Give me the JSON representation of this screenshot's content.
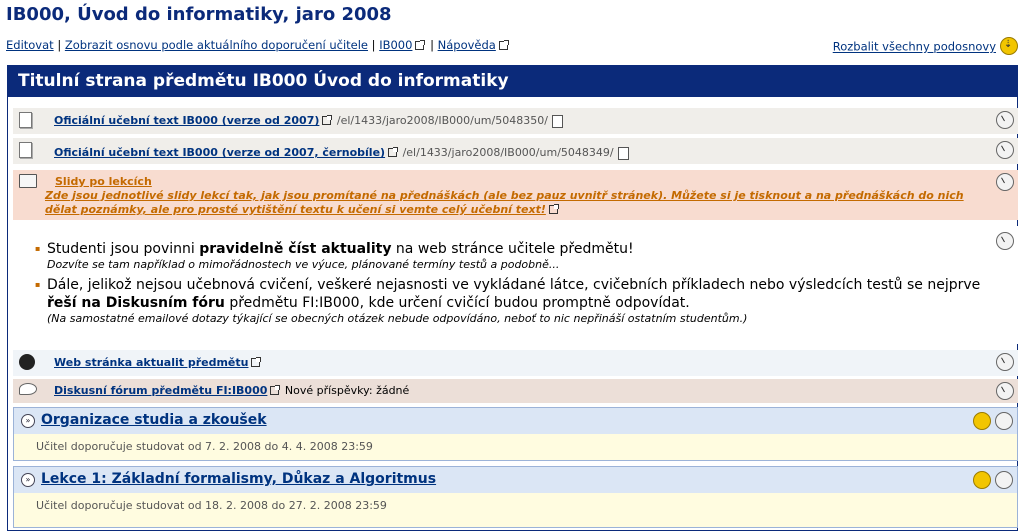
{
  "page_title": "IB000, Úvod do informatiky, jaro 2008",
  "topbar": {
    "edit": "Editovat",
    "sep1": "|",
    "outline": "Zobrazit osnovu podle aktuálního doporučení učitele",
    "sep2": "|",
    "course": "IB000",
    "sep3": "|",
    "help": "Nápověda",
    "expand_all": "Rozbalit všechny podosnovy"
  },
  "panel_title": "Titulní strana předmětu IB000 Úvod do informatiky",
  "rows": {
    "r1_link": "Oficiální učební text IB000 (verze od 2007)",
    "r1_path": "/el/1433/jaro2008/IB000/um/5048350/",
    "r2_link": "Oficiální učební text IB000 (verze od 2007, černobíle)",
    "r2_path": "/el/1433/jaro2008/IB000/um/5048349/",
    "r3_link": "Slidy po lekcích",
    "r3_note": "Zde jsou jednotlivé slidy lekcí tak, jak jsou promítané na přednáškách (ale bez pauz uvnitř stránek). Můžete si je tisknout a na přednáškách do nich dělat poznámky, ale pro prosté vytištění textu k učení si vemte celý učební text!",
    "b1_pre": "Studenti jsou povinni ",
    "b1_bold": "pravidelně číst aktuality",
    "b1_post": " na web stránce učitele předmětu!",
    "b1_small": "Dozvíte se tam například o mimořádnostech ve výuce, plánované termíny testů a podobně...",
    "b2_pre": "Dále, jelikož nejsou učebnová cvičení, veškeré nejasnosti ve vykládané látce, cvičebních příkladech nebo výsledcích testů se nejprve ",
    "b2_bold": "řeší na Diskusním fóru",
    "b2_post": " předmětu FI:IB000, kde určení cvičící budou promptně odpovídat.",
    "b2_small": "(Na samostatné emailové dotazy týkající se obecných otázek nebude odpovídáno, neboť to nic nepřináší ostatním studentům.)",
    "r5_link": "Web stránka aktualit předmětu",
    "r6_link": "Diskusní fórum předmětu FI:IB000",
    "r6_status": "Nové příspěvky: žádné"
  },
  "sections": [
    {
      "title": "Organizace studia a zkoušek",
      "recommend": "Učitel doporučuje studovat od 7. 2. 2008 do 4. 4. 2008 23:59"
    },
    {
      "title": "Lekce 1: Základní formalismy, Důkaz a Algoritmus",
      "recommend": "Učitel doporučuje studovat od 18. 2. 2008 do 27. 2. 2008 23:59"
    }
  ]
}
